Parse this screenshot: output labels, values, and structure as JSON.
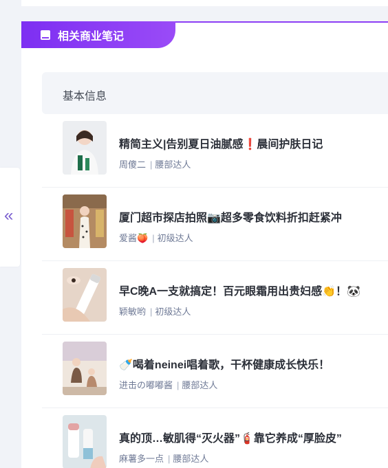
{
  "section": {
    "title": "相关商业笔记",
    "icon": "book-icon"
  },
  "info": {
    "label": "基本信息"
  },
  "collapse": {
    "icon": "double-chevron-left-icon",
    "glyph": "«"
  },
  "notes": [
    {
      "title": "精简主义|告别夏日油腻感❗晨间护肤日记",
      "author": "周傻二",
      "level": "腰部达人",
      "thumb_colors": [
        "#e9ecef",
        "#1e6e48",
        "#f5d4c5"
      ]
    },
    {
      "title": "厦门超市探店拍照📷超多零食饮料折扣赶紧冲",
      "author": "爱酱🍑",
      "level": "初级达人",
      "thumb_colors": [
        "#a7835f",
        "#f7f3ea",
        "#c89f5a"
      ]
    },
    {
      "title": "早C晚A一支就搞定！百元眼霜用出贵妇感👏！🐼",
      "author": "颖敏哟",
      "level": "初级达人",
      "thumb_colors": [
        "#e4d4c8",
        "#ffffff",
        "#b89a83"
      ]
    },
    {
      "title": "🍼喝着neinei唱着歌，干杯健康成长快乐！",
      "author": "进击の嘟嘟酱",
      "level": "腰部达人",
      "thumb_colors": [
        "#ede4db",
        "#8b6b55",
        "#d6cbd9"
      ]
    },
    {
      "title": "真的顶…敏肌得“灭火器”🧯靠它养成“厚脸皮”",
      "author": "麻薯多一点",
      "level": "腰部达人",
      "thumb_colors": [
        "#dfe7ea",
        "#ffffff",
        "#e8a8a8"
      ]
    }
  ]
}
